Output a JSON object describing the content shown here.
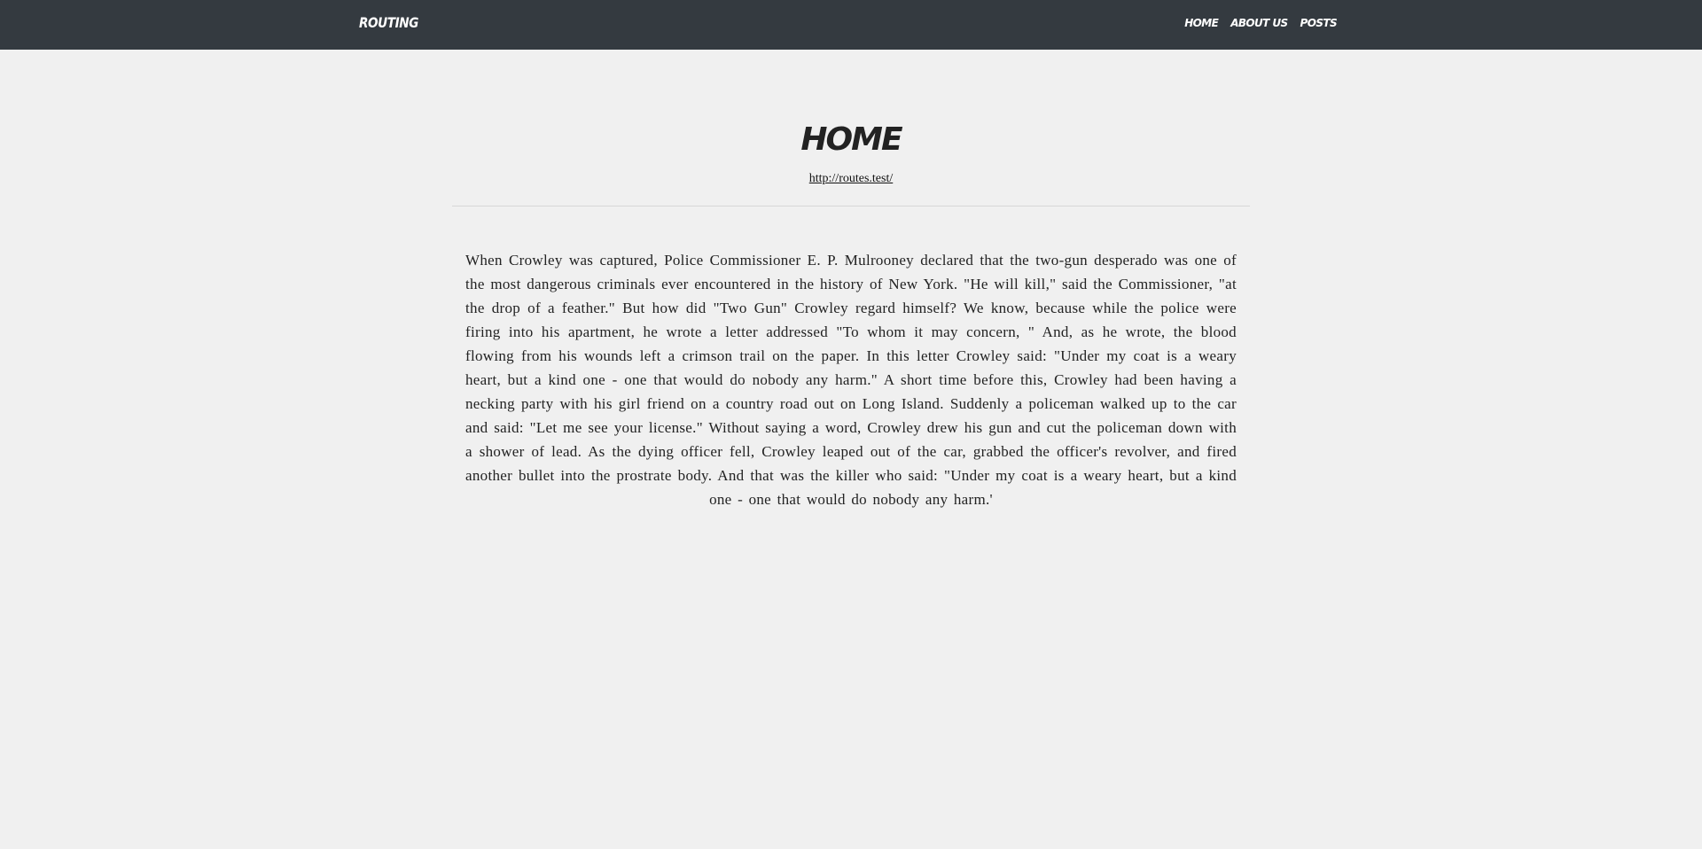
{
  "navbar": {
    "brand": "ROUTING",
    "links": [
      {
        "label": "HOME"
      },
      {
        "label": "ABOUT US"
      },
      {
        "label": "POSTS"
      }
    ]
  },
  "main": {
    "title": "HOME",
    "url": "http://routes.test/",
    "paragraph": "When Crowley was captured, Police Commissioner E. P. Mulrooney declared that the two-gun desperado was one of the most dangerous criminals ever encountered in the history of New York. \"He will kill,\" said the Commissioner, \"at the drop of a feather.\" But how did \"Two Gun\" Crowley regard himself? We know, because while the police were firing into his apartment, he wrote a letter addressed \"To whom it may concern, \" And, as he wrote, the blood flowing from his wounds left a crimson trail on the paper. In this letter Crowley said: \"Under my coat is a weary heart, but a kind one - one that would do nobody any harm.\" A short time before this, Crowley had been having a necking party with his girl friend on a country road out on Long Island. Suddenly a policeman walked up to the car and said: \"Let me see your license.\" Without saying a word, Crowley drew his gun and cut the policeman down with a shower of lead. As the dying officer fell, Crowley leaped out of the car, grabbed the officer's revolver, and fired another bullet into the prostrate body. And that was the killer who said: \"Under my coat is a weary heart, but a kind one - one that would do nobody any harm.'"
  },
  "colors": {
    "navbar_bg": "#343a40",
    "page_bg": "#f0f0f0",
    "text": "#222222"
  }
}
